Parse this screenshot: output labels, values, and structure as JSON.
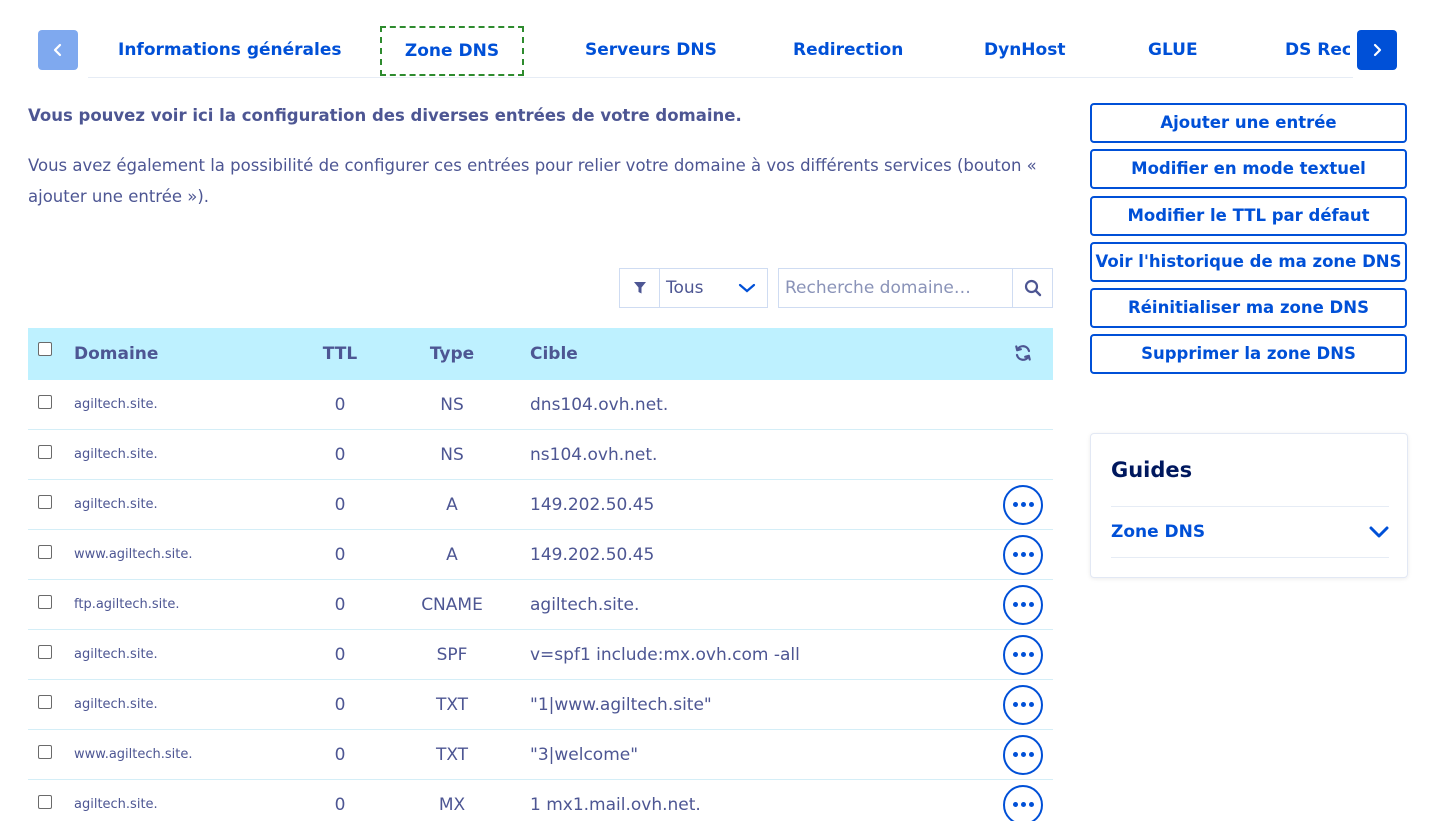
{
  "tabs": {
    "items": [
      {
        "label": "Informations générales"
      },
      {
        "label": "Zone DNS",
        "active": true
      },
      {
        "label": "Serveurs DNS"
      },
      {
        "label": "Redirection"
      },
      {
        "label": "DynHost"
      },
      {
        "label": "GLUE"
      },
      {
        "label": "DS Records"
      }
    ],
    "prev_icon": "chevron-left-icon",
    "next_icon": "chevron-right-icon"
  },
  "intro": {
    "title": "Vous pouvez voir ici la configuration des diverses entrées de votre domaine.",
    "text": "Vous avez également la possibilité de configurer ces entrées pour relier votre domaine à vos différents services (bouton « ajouter une entrée »)."
  },
  "filter": {
    "icon": "filter-icon",
    "selected": "Tous"
  },
  "search": {
    "placeholder": "Recherche domaine…",
    "icon": "search-icon"
  },
  "table": {
    "columns": {
      "domain": "Domaine",
      "ttl": "TTL",
      "type": "Type",
      "target": "Cible"
    },
    "refresh_icon": "refresh-icon",
    "rows": [
      {
        "domain": "agiltech.site.",
        "ttl": "0",
        "type": "NS",
        "target": "dns104.ovh.net.",
        "has_actions": false
      },
      {
        "domain": "agiltech.site.",
        "ttl": "0",
        "type": "NS",
        "target": "ns104.ovh.net.",
        "has_actions": false
      },
      {
        "domain": "agiltech.site.",
        "ttl": "0",
        "type": "A",
        "target": "149.202.50.45",
        "has_actions": true
      },
      {
        "domain": "www.agiltech.site.",
        "ttl": "0",
        "type": "A",
        "target": "149.202.50.45",
        "has_actions": true
      },
      {
        "domain": "ftp.agiltech.site.",
        "ttl": "0",
        "type": "CNAME",
        "target": "agiltech.site.",
        "has_actions": true
      },
      {
        "domain": "agiltech.site.",
        "ttl": "0",
        "type": "SPF",
        "target": "v=spf1 include:mx.ovh.com -all",
        "has_actions": true
      },
      {
        "domain": "agiltech.site.",
        "ttl": "0",
        "type": "TXT",
        "target": "\"1|www.agiltech.site\"",
        "has_actions": true
      },
      {
        "domain": "www.agiltech.site.",
        "ttl": "0",
        "type": "TXT",
        "target": "\"3|welcome\"",
        "has_actions": true
      },
      {
        "domain": "agiltech.site.",
        "ttl": "0",
        "type": "MX",
        "target": "1 mx1.mail.ovh.net.",
        "has_actions": true
      }
    ]
  },
  "actions": [
    {
      "label": "Ajouter une entrée"
    },
    {
      "label": "Modifier en mode textuel"
    },
    {
      "label": "Modifier le TTL par défaut"
    },
    {
      "label": "Voir l'historique de ma zone DNS"
    },
    {
      "label": "Réinitialiser ma zone DNS"
    },
    {
      "label": "Supprimer la zone DNS"
    }
  ],
  "guides": {
    "title": "Guides",
    "item": "Zone DNS",
    "item_icon": "chevron-down-icon"
  },
  "colors": {
    "accent": "#0050d7",
    "text": "#4d5693",
    "header_bg": "#bef1ff",
    "active_tab_border": "#2e8b2e"
  }
}
